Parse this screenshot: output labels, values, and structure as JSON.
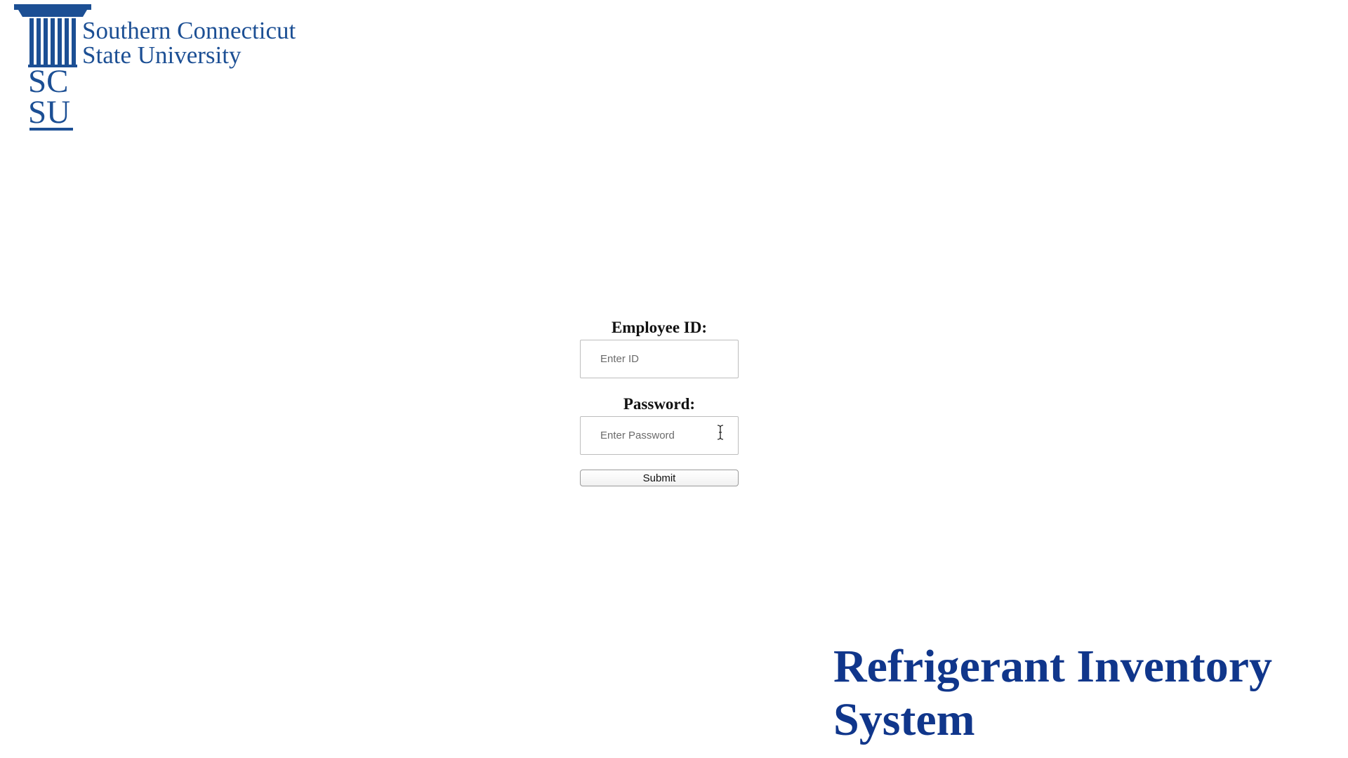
{
  "logo": {
    "line1": "Southern Connecticut",
    "line2": "State University",
    "initials_top": "SC",
    "initials_bottom": "SU",
    "icon": "column-icon",
    "color": "#1c4f94"
  },
  "form": {
    "employee_id_label": "Employee ID:",
    "employee_id_placeholder": "Enter ID",
    "password_label": "Password:",
    "password_placeholder": "Enter Password",
    "submit_label": "Submit"
  },
  "cursor": {
    "icon": "text-cursor-icon"
  },
  "title": {
    "line1": "Refrigerant Inventory",
    "line2": "System",
    "color": "#10368b"
  }
}
